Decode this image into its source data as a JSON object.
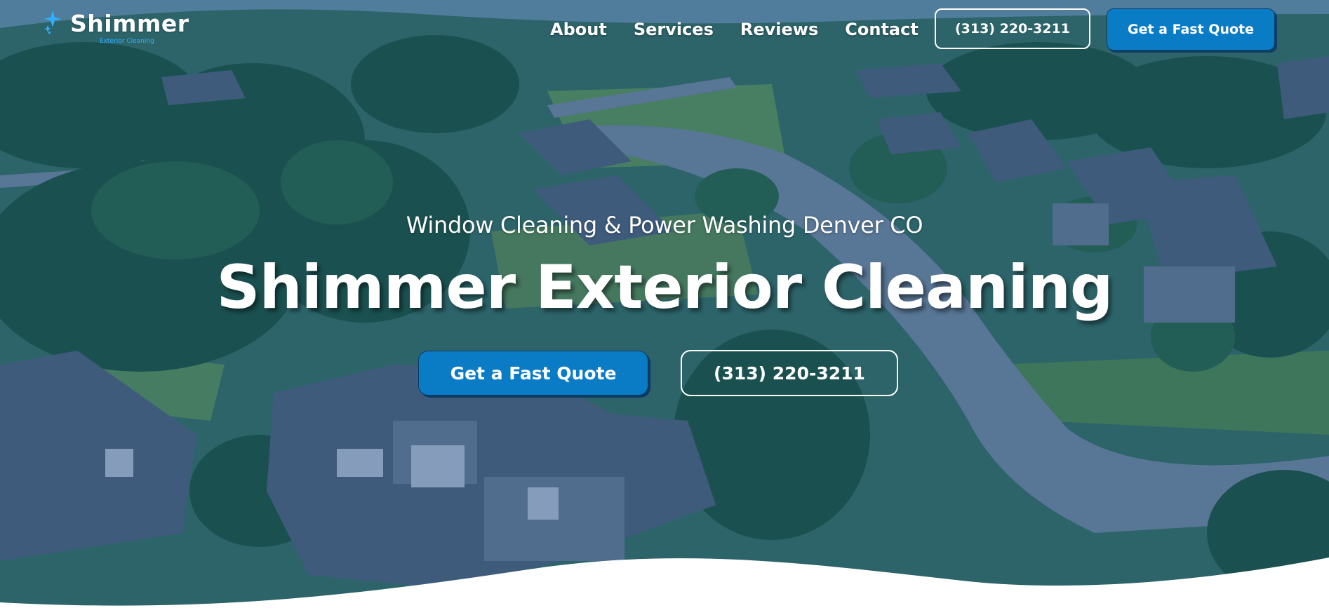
{
  "brand": {
    "name": "Shimmer",
    "tagline": "Exterior Cleaning",
    "accent": "#0a7cc6",
    "accent_dark": "#0b3a62",
    "logo_star_color": "#2fb0ff"
  },
  "nav": {
    "items": [
      {
        "label": "About"
      },
      {
        "label": "Services"
      },
      {
        "label": "Reviews"
      },
      {
        "label": "Contact"
      }
    ],
    "phone_label": "(313) 220-3211",
    "quote_label": "Get a Fast Quote"
  },
  "hero": {
    "subtitle": "Window Cleaning & Power Washing Denver CO",
    "title": "Shimmer Exterior Cleaning",
    "cta_quote_label": "Get a Fast Quote",
    "cta_phone_label": "(313) 220-3211",
    "background": "aerial-neighborhood-photo"
  }
}
